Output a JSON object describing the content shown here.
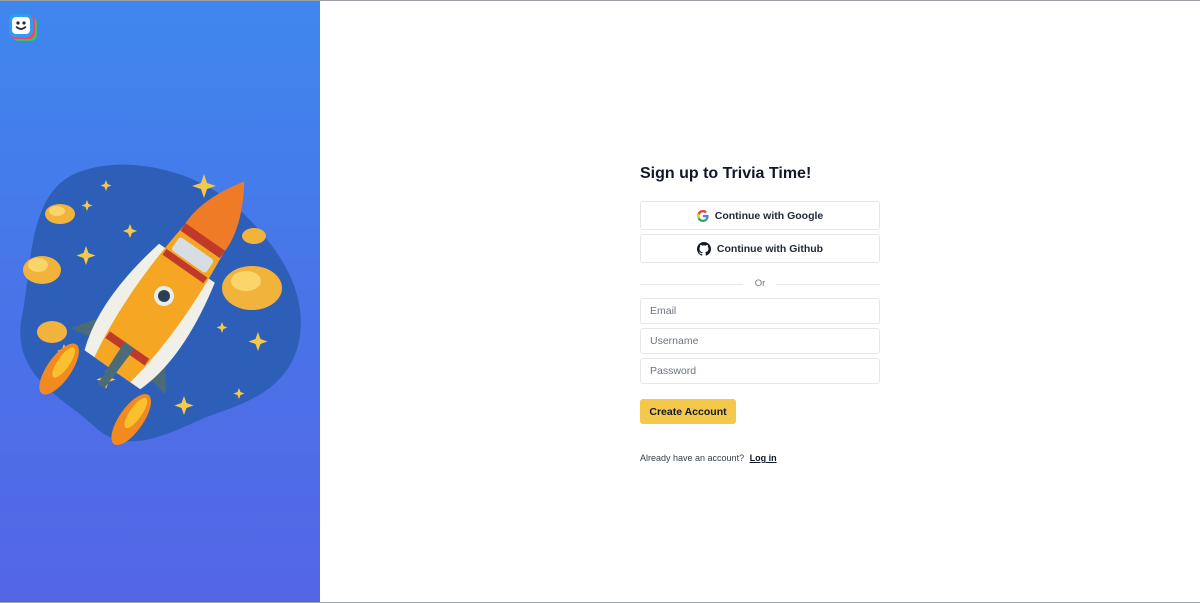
{
  "brand": {
    "logo_icon": "smiley-app-logo-icon",
    "colors": {
      "panel_top": "#3f87ee",
      "panel_bottom": "#5466e6",
      "accent": "#f4c84a"
    }
  },
  "illustration": {
    "icon": "rocket-illustration"
  },
  "signup": {
    "title": "Sign up to Trivia Time!",
    "google_label": "Continue with Google",
    "google_icon": "google-icon",
    "github_label": "Continue with Github",
    "github_icon": "github-icon",
    "divider_text": "Or",
    "email_placeholder": "Email",
    "username_placeholder": "Username",
    "password_placeholder": "Password",
    "create_label": "Create Account",
    "login_prompt": "Already have an account?",
    "login_link": "Log in"
  }
}
